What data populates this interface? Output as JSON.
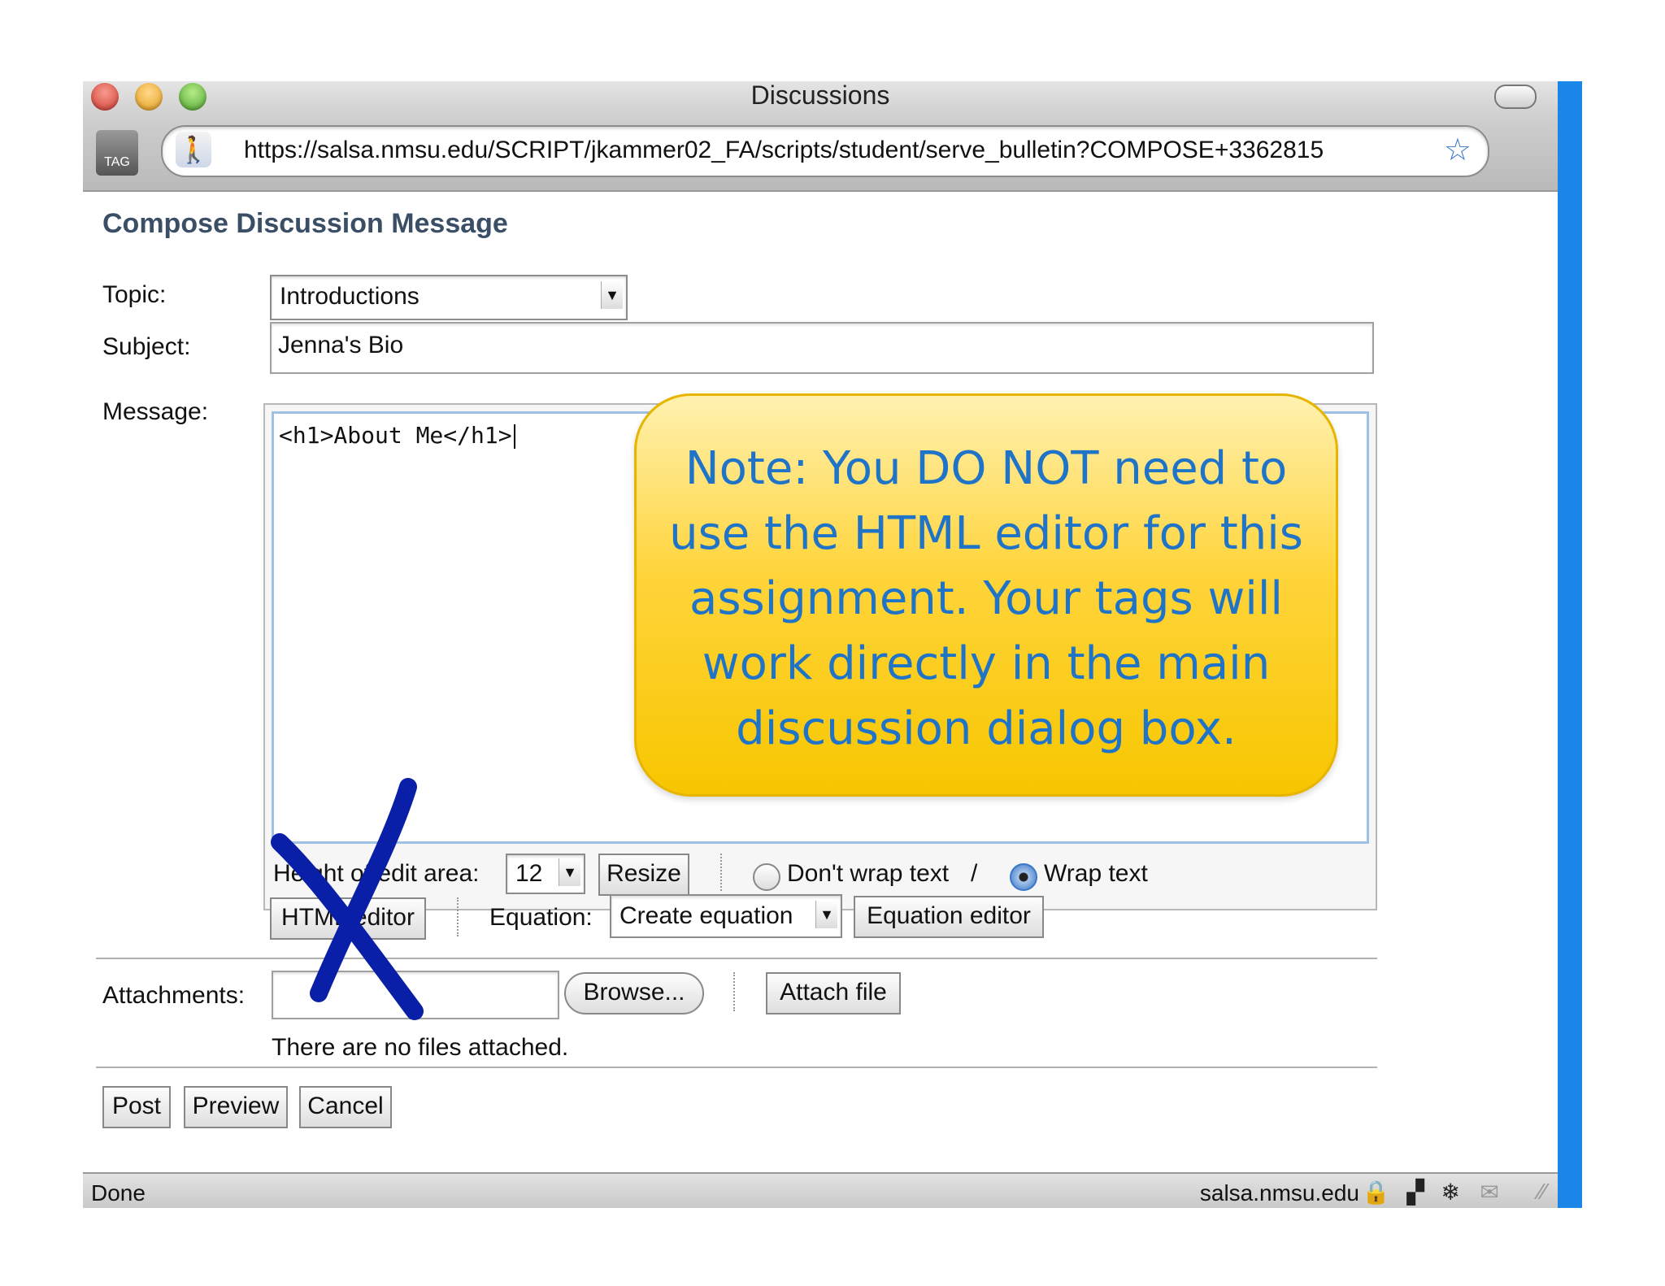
{
  "window": {
    "title": "Discussions",
    "tag_label": "TAG",
    "url": "https://salsa.nmsu.edu/SCRIPT/jkammer02_FA/scripts/student/serve_bulletin?COMPOSE+3362815",
    "site_icon": "walking-figure-icon",
    "bookmark_icon": "star-icon"
  },
  "form": {
    "heading": "Compose Discussion Message",
    "topic_label": "Topic:",
    "topic_value": "Introductions",
    "subject_label": "Subject:",
    "subject_value": "Jenna's Bio",
    "message_label": "Message:",
    "message_value": "<h1>About Me</h1>",
    "height_label": "Height of edit area:",
    "height_value": "12",
    "resize_label": "Resize",
    "dont_wrap_label": "Don't wrap text",
    "slash": "/",
    "wrap_label": "Wrap text",
    "wrap_selected": "Wrap text",
    "html_editor_label": "HTML editor",
    "equation_label": "Equation:",
    "equation_value": "Create equation",
    "equation_editor_label": "Equation editor",
    "attachments_label": "Attachments:",
    "browse_label": "Browse...",
    "attach_label": "Attach file",
    "no_files_text": "There are no files attached.",
    "post_label": "Post",
    "preview_label": "Preview",
    "cancel_label": "Cancel"
  },
  "status": {
    "left": "Done",
    "host": "salsa.nmsu.edu"
  },
  "annotation": {
    "note": "Note: You DO NOT need to use the HTML editor for this assignment. Your tags will work directly in the main discussion dialog box.",
    "note_color": "#1f74c8",
    "x_mark_color": "#0a1fa8"
  }
}
